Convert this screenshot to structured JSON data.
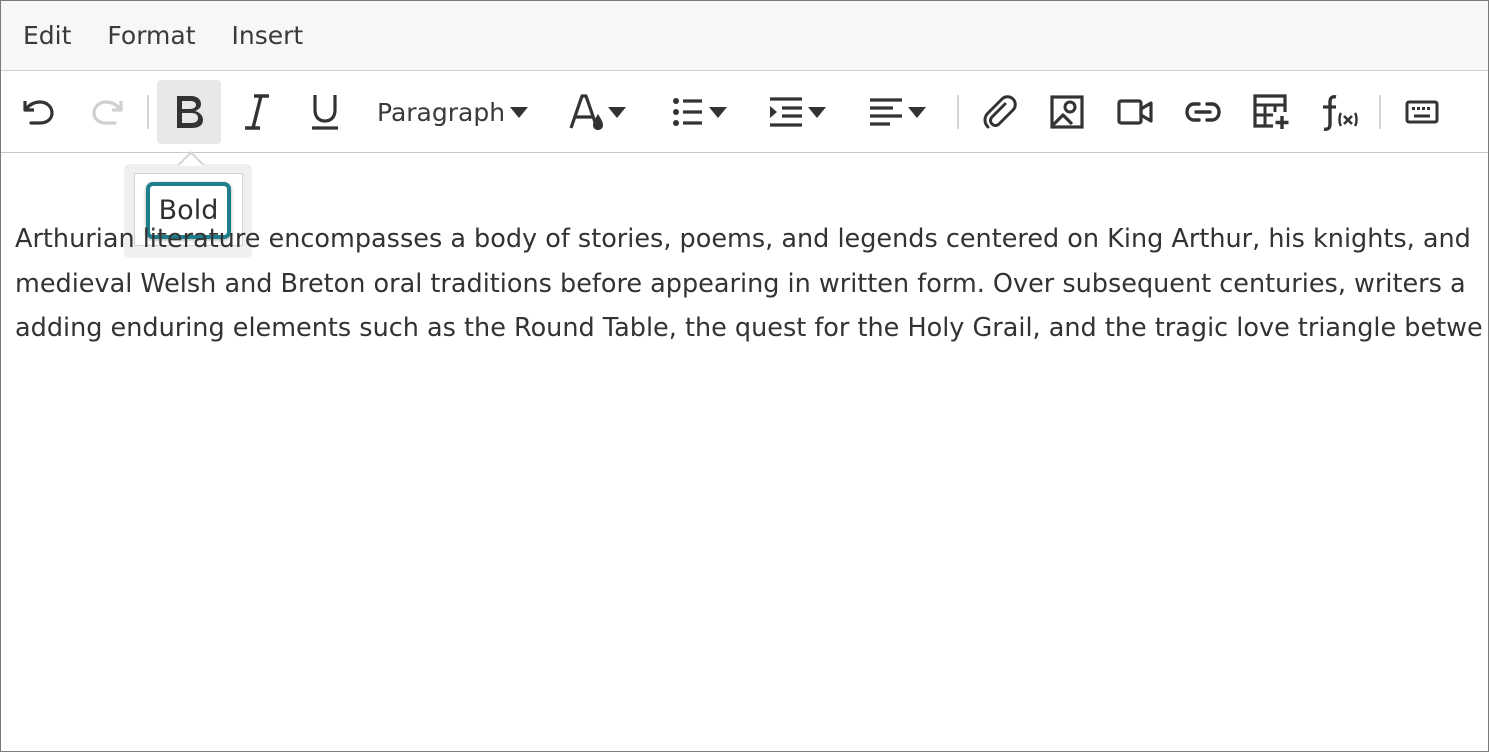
{
  "menubar": {
    "items": [
      {
        "label": "Edit"
      },
      {
        "label": "Format"
      },
      {
        "label": "Insert"
      }
    ]
  },
  "toolbar": {
    "undo": "undo-icon",
    "redo": "redo-icon",
    "bold": "bold-icon",
    "italic": "italic-icon",
    "underline": "underline-icon",
    "block_format_label": "Paragraph",
    "text_color": "text-color-icon",
    "list": "bullet-list-icon",
    "indent": "indent-icon",
    "align": "align-left-icon",
    "attach": "paperclip-icon",
    "image": "image-icon",
    "video": "video-icon",
    "link": "link-icon",
    "table": "table-icon",
    "math": "formula-icon",
    "keyboard": "keyboard-icon"
  },
  "tooltip": {
    "text": "Bold"
  },
  "content": {
    "lines": [
      "Arthurian literature encompasses a body of stories, poems, and legends centered on King Arthur, his knights, and",
      "medieval Welsh and Breton oral traditions before appearing in written form. Over subsequent centuries, writers a",
      "adding enduring elements such as the Round Table, the quest for the Holy Grail, and the tragic love triangle betwe"
    ]
  },
  "colors": {
    "focus_ring": "#1e7e8c",
    "active_button_bg": "#e8e8e8",
    "menubar_bg": "#f7f7f7",
    "disabled_icon": "#d0d0d0"
  }
}
